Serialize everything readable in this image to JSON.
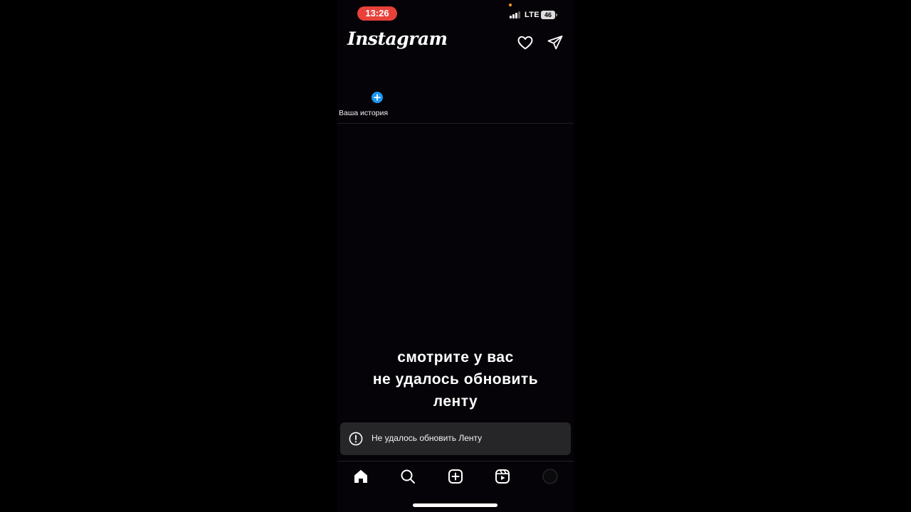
{
  "status_bar": {
    "time": "13:26",
    "network": "LTE",
    "battery": "46"
  },
  "header": {
    "logo": "Instagram",
    "icons": [
      "heart-icon",
      "direct-message-icon"
    ]
  },
  "stories": {
    "your_story_label": "Ваша история"
  },
  "caption": {
    "lines": [
      "смотрите у вас",
      "не удалось обновить",
      "ленту"
    ]
  },
  "toast": {
    "message": "Не удалось обновить Ленту",
    "icon": "alert-circle-icon"
  },
  "tab_bar": {
    "tabs": [
      "home-icon",
      "search-icon",
      "create-icon",
      "reels-icon",
      "profile-avatar"
    ],
    "active": "home-icon"
  },
  "colors": {
    "background": "#050307",
    "time_pill": "#e8413a",
    "story_plus": "#1d96f3",
    "toast_bg": "#262629"
  }
}
